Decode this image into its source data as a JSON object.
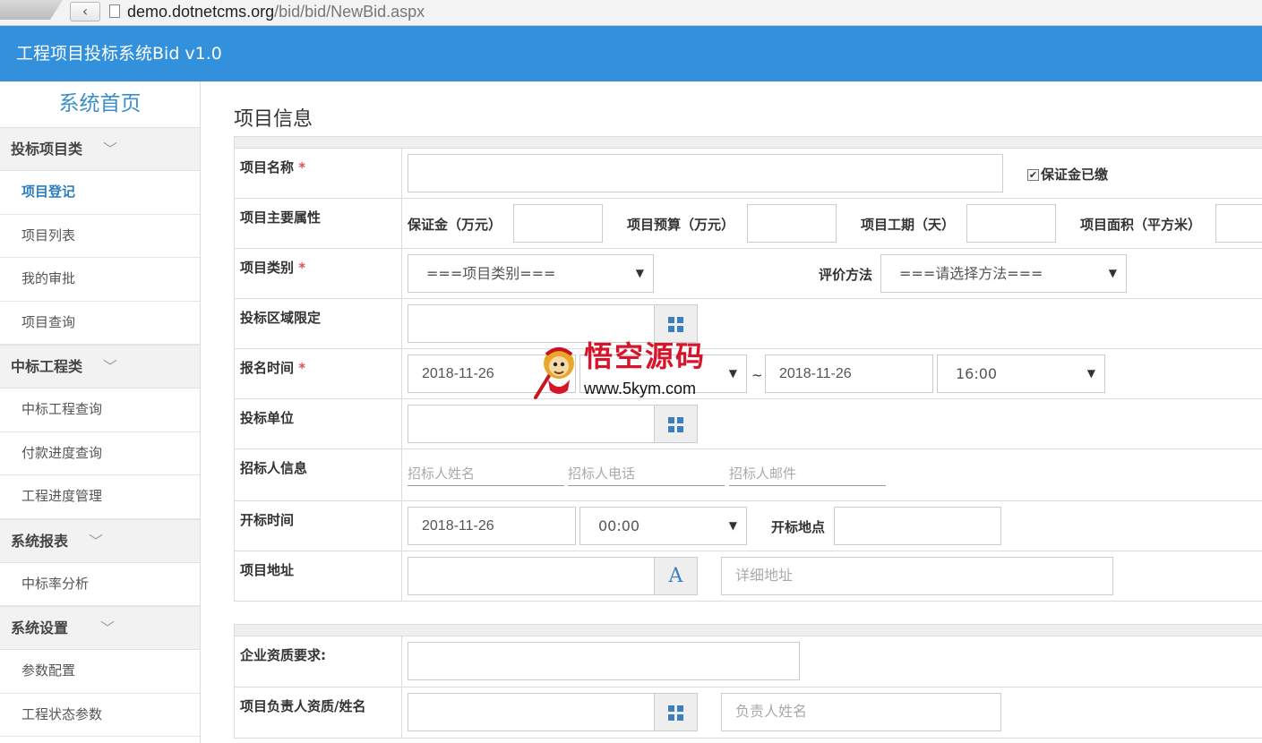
{
  "browser": {
    "back_glyph": "‹",
    "url_host": "demo.dotnetcms.org",
    "url_path": "/bid/bid/NewBid.aspx"
  },
  "header": {
    "title": "工程项目投标系统Bid v1.0"
  },
  "sidebar": {
    "home": "系统首页",
    "chevron": "﹀",
    "groups": [
      {
        "label": "投标项目类",
        "items": [
          "项目登记",
          "项目列表",
          "我的审批",
          "项目查询"
        ]
      },
      {
        "label": "中标工程类",
        "items": [
          "中标工程查询",
          "付款进度查询",
          "工程进度管理"
        ]
      },
      {
        "label": "系统报表",
        "items": [
          "中标率分析"
        ]
      },
      {
        "label": "系统设置",
        "items": [
          "参数配置",
          "工程状态参数"
        ]
      }
    ]
  },
  "main": {
    "section_title": "项目信息",
    "required_mark": "*",
    "rows": {
      "name": {
        "label": "项目名称",
        "checkbox_label": "保证金已缴",
        "checkbox_checked": true,
        "check_glyph": "✔"
      },
      "attrs": {
        "label": "项目主要属性",
        "deposit": "保证金（万元）",
        "budget": "项目预算（万元）",
        "duration": "项目工期（天）",
        "area": "项目面积（平方米）"
      },
      "category": {
        "label": "项目类别",
        "select_value": "===项目类别===",
        "method_label": "评价方法",
        "method_value": "===请选择方法==="
      },
      "region": {
        "label": "投标区域限定"
      },
      "signup": {
        "label": "报名时间",
        "start_date": "2018-11-26",
        "tilde": "~",
        "end_date": "2018-11-26",
        "end_time": "16:00"
      },
      "unit": {
        "label": "投标单位"
      },
      "tenderer": {
        "label": "招标人信息",
        "name_ph": "招标人姓名",
        "phone_ph": "招标人电话",
        "email_ph": "招标人邮件"
      },
      "opening": {
        "label": "开标时间",
        "date": "2018-11-26",
        "time": "00:00",
        "place_label": "开标地点"
      },
      "address": {
        "label": "项目地址",
        "addon_letter": "A",
        "detail_ph": "详细地址"
      }
    },
    "rows2": {
      "qualification": {
        "label": "企业资质要求:"
      },
      "manager": {
        "label": "项目负责人资质/姓名",
        "name_ph": "负责人姓名"
      }
    },
    "select_arrow": "▼"
  },
  "watermark": {
    "cn": "悟空源码",
    "en": "www.5kym.com"
  }
}
